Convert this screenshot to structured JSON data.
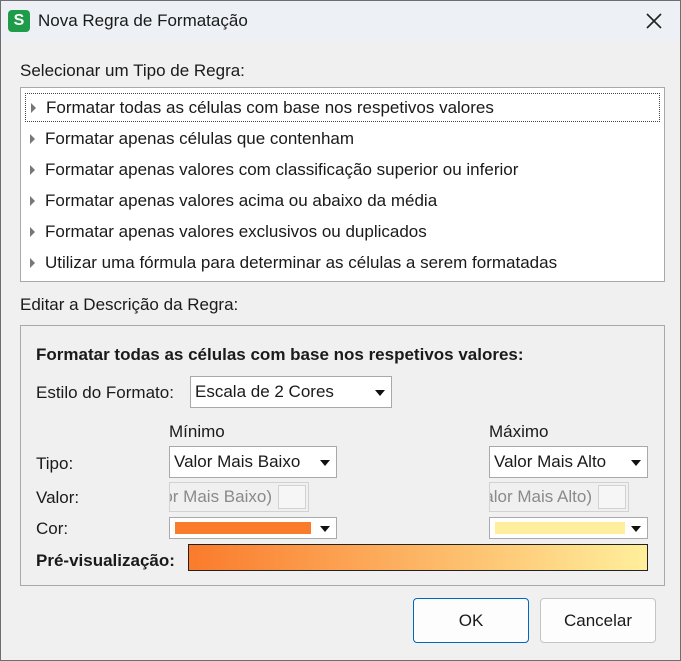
{
  "window": {
    "title": "Nova Regra de Formatação",
    "app_icon_letter": "S",
    "app_icon_color": "#1e9c4a"
  },
  "rule_type": {
    "heading": "Selecionar um Tipo de Regra:",
    "items": [
      {
        "label": "Formatar todas as células com base nos respetivos valores",
        "selected": true
      },
      {
        "label": "Formatar apenas células que contenham",
        "selected": false
      },
      {
        "label": "Formatar apenas valores com classificação superior ou inferior",
        "selected": false
      },
      {
        "label": "Formatar apenas valores acima ou abaixo da média",
        "selected": false
      },
      {
        "label": "Formatar apenas valores exclusivos ou duplicados",
        "selected": false
      },
      {
        "label": "Utilizar uma fórmula para determinar as células a serem formatadas",
        "selected": false
      }
    ]
  },
  "description": {
    "heading": "Editar a Descrição da Regra:",
    "title": "Formatar todas as células com base nos respetivos valores:",
    "format_style_label": "Estilo do Formato:",
    "format_style_value": "Escala de 2 Cores",
    "min_header": "Mínimo",
    "max_header": "Máximo",
    "type_label": "Tipo:",
    "value_label": "Valor:",
    "color_label": "Cor:",
    "min_type": "Valor Mais Baixo",
    "max_type": "Valor Mais Alto",
    "min_value": "(Valor Mais Baixo)",
    "max_value": "(Valor Mais Alto)",
    "min_color": "#fa7b2c",
    "max_color": "#ffef9c",
    "preview_label": "Pré-visualização:"
  },
  "buttons": {
    "ok": "OK",
    "cancel": "Cancelar"
  }
}
